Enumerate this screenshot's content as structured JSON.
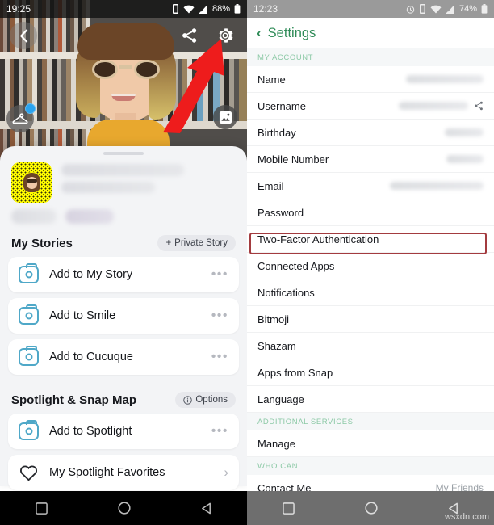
{
  "left_panel": {
    "status_bar": {
      "time": "19:25",
      "battery": "88%",
      "icons": [
        "vibrate-icon",
        "wifi-icon",
        "signal-icon",
        "battery-icon"
      ]
    },
    "topbar": {
      "back": "back-chevron-icon",
      "share": "share-icon",
      "settings": "gear-icon"
    },
    "badges": {
      "wardrobe": "hanger-icon",
      "notification_dot": "blue-dot",
      "memories": "photo-icon"
    },
    "annotation": {
      "arrow": "red-arrow-pointing-to-gear",
      "color": "#ee1c1c"
    },
    "profile": {
      "snapcode": "snapcode-qr",
      "name_redacted": true,
      "username_redacted": true
    },
    "my_stories": {
      "title": "My Stories",
      "action": {
        "label": "Private Story",
        "icon": "plus-icon"
      },
      "items": [
        {
          "label": "Add to My Story",
          "icon": "camera-icon",
          "menu": "more-dots-icon"
        },
        {
          "label": "Add to Smile",
          "icon": "camera-icon",
          "menu": "more-dots-icon"
        },
        {
          "label": "Add to Cucuque",
          "icon": "camera-icon",
          "menu": "more-dots-icon"
        }
      ]
    },
    "spotlight": {
      "title": "Spotlight & Snap Map",
      "action": {
        "label": "Options",
        "icon": "info-icon"
      },
      "items": [
        {
          "label": "Add to Spotlight",
          "icon": "camera-icon",
          "menu": "more-dots-icon"
        },
        {
          "label": "My Spotlight Favorites",
          "icon": "heart-icon",
          "menu": "chevron-right-icon"
        }
      ]
    },
    "nav": {
      "recents": "square-icon",
      "home": "circle-icon",
      "back": "triangle-icon"
    }
  },
  "right_panel": {
    "status_bar": {
      "time": "12:23",
      "battery": "74%",
      "icons": [
        "alarm-icon",
        "vibrate-icon",
        "wifi-icon",
        "signal-icon",
        "battery-icon"
      ]
    },
    "header": {
      "title": "Settings",
      "back": "back-chevron-icon"
    },
    "groups": [
      {
        "header": "MY ACCOUNT",
        "rows": [
          {
            "label": "Name",
            "value_redacted": true,
            "value_width": 96
          },
          {
            "label": "Username",
            "value_redacted": true,
            "value_width": 86,
            "trailing_icon": "share-icon"
          },
          {
            "label": "Birthday",
            "value_redacted": true,
            "value_width": 48
          },
          {
            "label": "Mobile Number",
            "value_redacted": true,
            "value_width": 46
          },
          {
            "label": "Email",
            "value_redacted": true,
            "value_width": 116
          },
          {
            "label": "Password",
            "value_redacted": false
          },
          {
            "label": "Two-Factor Authentication",
            "value_redacted": false,
            "highlighted": true
          },
          {
            "label": "Connected Apps",
            "value_redacted": false
          },
          {
            "label": "Notifications",
            "value_redacted": false
          },
          {
            "label": "Bitmoji",
            "value_redacted": false
          },
          {
            "label": "Shazam",
            "value_redacted": false
          },
          {
            "label": "Apps from Snap",
            "value_redacted": false
          },
          {
            "label": "Language",
            "value_redacted": false
          }
        ]
      },
      {
        "header": "ADDITIONAL SERVICES",
        "rows": [
          {
            "label": "Manage",
            "value_redacted": false
          }
        ]
      },
      {
        "header": "WHO CAN...",
        "rows": [
          {
            "label": "Contact Me",
            "value": "My Friends"
          }
        ]
      }
    ],
    "nav": {
      "recents": "square-icon",
      "home": "circle-icon",
      "back": "triangle-icon"
    },
    "watermark": "wsxdn.com"
  },
  "colors": {
    "accent_green": "#2e8b57",
    "group_header_green": "#8cc9a6",
    "highlight_red": "#a33b3f",
    "arrow_red": "#ee1c1c",
    "camera_blue": "#4fa8c8",
    "snapcode_yellow": "#fffc00"
  }
}
